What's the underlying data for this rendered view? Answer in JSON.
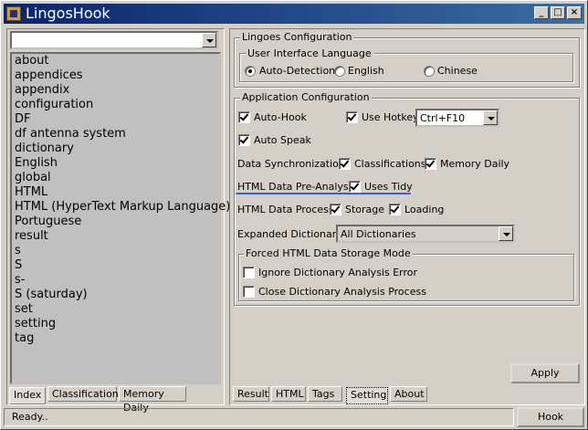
{
  "window": {
    "title": "LingosHook",
    "min_label": "_",
    "max_label": "□",
    "close_label": "×"
  },
  "left": {
    "search_value": "",
    "items": [
      "about",
      "appendices",
      "appendix",
      "configuration",
      "DF",
      "df antenna system",
      "dictionary",
      "English",
      "global",
      "HTML",
      "HTML (HyperText Markup Language)",
      "Portuguese",
      "result",
      "s",
      "S",
      "s-",
      "S (saturday)",
      "set",
      "setting",
      "tag"
    ],
    "tabs": [
      "Index",
      "Classifications",
      "Memory Daily"
    ]
  },
  "lingoes_config": {
    "title": "Lingoes Configuration",
    "ui_lang": {
      "title": "User Interface Language",
      "options": [
        "Auto-Detection",
        "English",
        "Chinese"
      ],
      "selected": "Auto-Detection"
    }
  },
  "app_config": {
    "title": "Application Configuration",
    "auto_hook": "Auto-Hook",
    "use_hotkey": "Use Hotkey",
    "hotkey_value": "Ctrl+F10",
    "auto_speak": "Auto Speak",
    "data_sync_label": "Data Synchronization",
    "classifications": "Classifications",
    "memory_daily": "Memory Daily",
    "pre_analyse_label": "HTML Data Pre-Analyse",
    "uses_tidy": "Uses Tidy",
    "process_label": "HTML Data Process",
    "storage": "Storage",
    "loading": "Loading",
    "expanded_label": "Expanded Dictionary",
    "expanded_value": "All Dictionaries",
    "forced": {
      "title": "Forced HTML Data Storage Mode",
      "ignore_error": "Ignore Dictionary Analysis Error",
      "close_process": "Close Dictionary Analysis Process"
    }
  },
  "apply_label": "Apply",
  "right_tabs": [
    "Result",
    "HTML",
    "Tags",
    "Setting",
    "About"
  ],
  "status": {
    "text": "Ready..",
    "hook_label": "Hook"
  },
  "icons": {
    "app": "app-logo-icon",
    "dropdown": "chevron-down-icon"
  }
}
